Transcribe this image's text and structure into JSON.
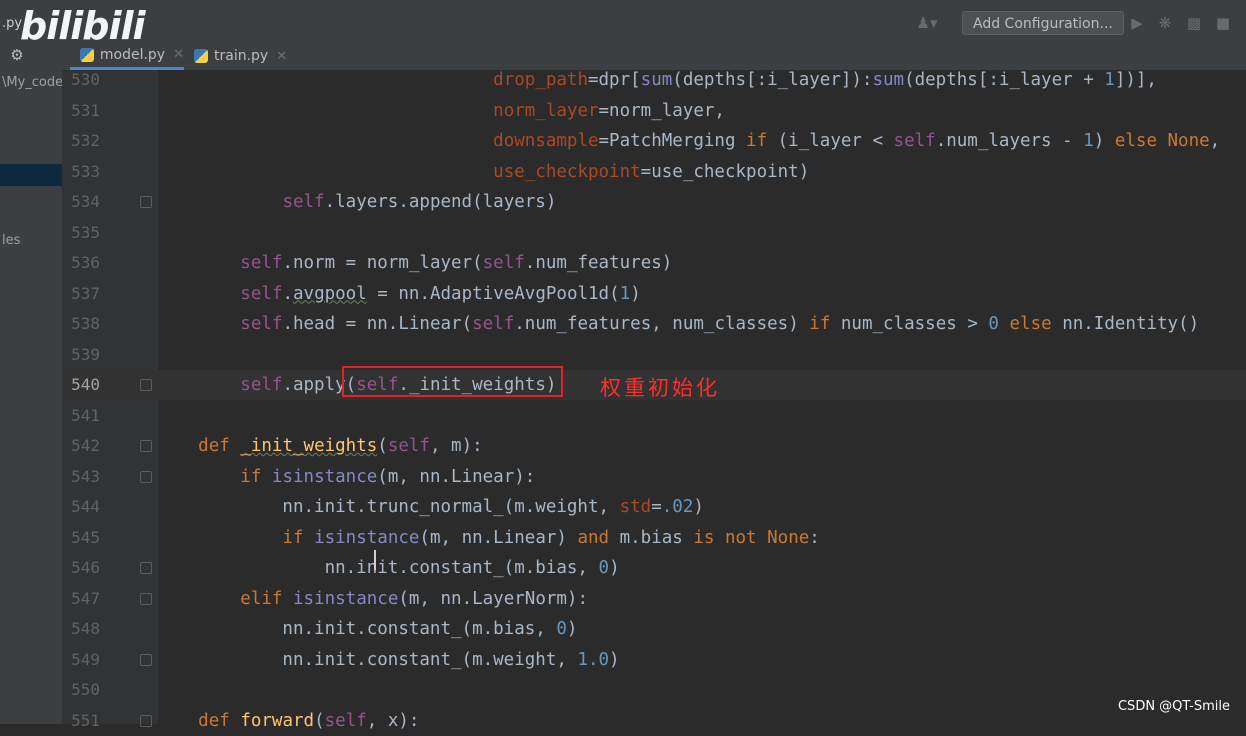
{
  "overlay": {
    "logo_text": "bilibili",
    "annotation": "权重初始化",
    "watermark": "CSDN @QT-Smile"
  },
  "toolbar": {
    "add_configuration": "Add Configuration..."
  },
  "tabs": [
    {
      "label": "model.py",
      "active": true
    },
    {
      "label": "train.py",
      "active": false
    }
  ],
  "project_panel": {
    "top_file": ".py",
    "path": "\\My_code",
    "item": "les"
  },
  "editor": {
    "current_line": 540,
    "lines": [
      {
        "n": 530,
        "html": "                                <span class=\"param\">drop_path</span>=dpr[<span class=\"bi\">sum</span>(depths[:i_layer]):<span class=\"bi\">sum</span>(depths[:i_layer + <span class=\"num\">1</span>])],"
      },
      {
        "n": 531,
        "html": "                                <span class=\"param\">norm_layer</span>=norm_layer,"
      },
      {
        "n": 532,
        "html": "                                <span class=\"param\">downsample</span>=PatchMerging <span class=\"kw\">if</span> (i_layer &lt; <span class=\"self\">self</span>.num_layers - <span class=\"num\">1</span>) <span class=\"kw\">else None</span>,"
      },
      {
        "n": 533,
        "html": "                                <span class=\"param\">use_checkpoint</span>=use_checkpoint)"
      },
      {
        "n": 534,
        "html": "            <span class=\"self\">self</span>.layers.append(layers)"
      },
      {
        "n": 535,
        "html": ""
      },
      {
        "n": 536,
        "html": "        <span class=\"self\">self</span>.norm = norm_layer(<span class=\"self\">self</span>.num_features)"
      },
      {
        "n": 537,
        "html": "        <span class=\"self\">self</span>.<span class=\"wavy\">avgpool</span> = nn.AdaptiveAvgPool1d(<span class=\"num\">1</span>)"
      },
      {
        "n": 538,
        "html": "        <span class=\"self\">self</span>.head = nn.Linear(<span class=\"self\">self</span>.num_features, num_classes) <span class=\"kw\">if</span> num_classes &gt; <span class=\"num\">0</span> <span class=\"kw\">else</span> nn.Identity()"
      },
      {
        "n": 539,
        "html": ""
      },
      {
        "n": 540,
        "html": "        <span class=\"self\">self</span>.apply(<span class=\"self\">self</span>._init_weights)"
      },
      {
        "n": 541,
        "html": ""
      },
      {
        "n": 542,
        "html": "    <span class=\"kw\">def</span> <span class=\"fn wavy\">_init_weights</span>(<span class=\"self\">self</span>, m):"
      },
      {
        "n": 543,
        "html": "        <span class=\"kw\">if</span> <span class=\"bi\">isinstance</span>(m, nn.Linear):"
      },
      {
        "n": 544,
        "html": "            nn.init.trunc_normal_(m.weight, <span class=\"param\">std</span>=<span class=\"num\">.02</span>)"
      },
      {
        "n": 545,
        "html": "            <span class=\"kw\">if</span> <span class=\"bi\">isinstance</span>(m, nn.Linear) <span class=\"kw\">and</span> m.bias <span class=\"kw\">is not None</span>:"
      },
      {
        "n": 546,
        "html": "                nn.init.constant_(m.bias, <span class=\"num\">0</span>)"
      },
      {
        "n": 547,
        "html": "        <span class=\"kw\">elif</span> <span class=\"bi\">isinstance</span>(m, nn.LayerNorm):"
      },
      {
        "n": 548,
        "html": "            nn.init.constant_(m.bias, <span class=\"num\">0</span>)"
      },
      {
        "n": 549,
        "html": "            nn.init.constant_(m.weight, <span class=\"num\">1.0</span>)"
      },
      {
        "n": 550,
        "html": ""
      },
      {
        "n": 551,
        "html": "    <span class=\"kw\">def</span> <span class=\"fn\">forward</span>(<span class=\"self\">self</span>, x):"
      }
    ]
  }
}
